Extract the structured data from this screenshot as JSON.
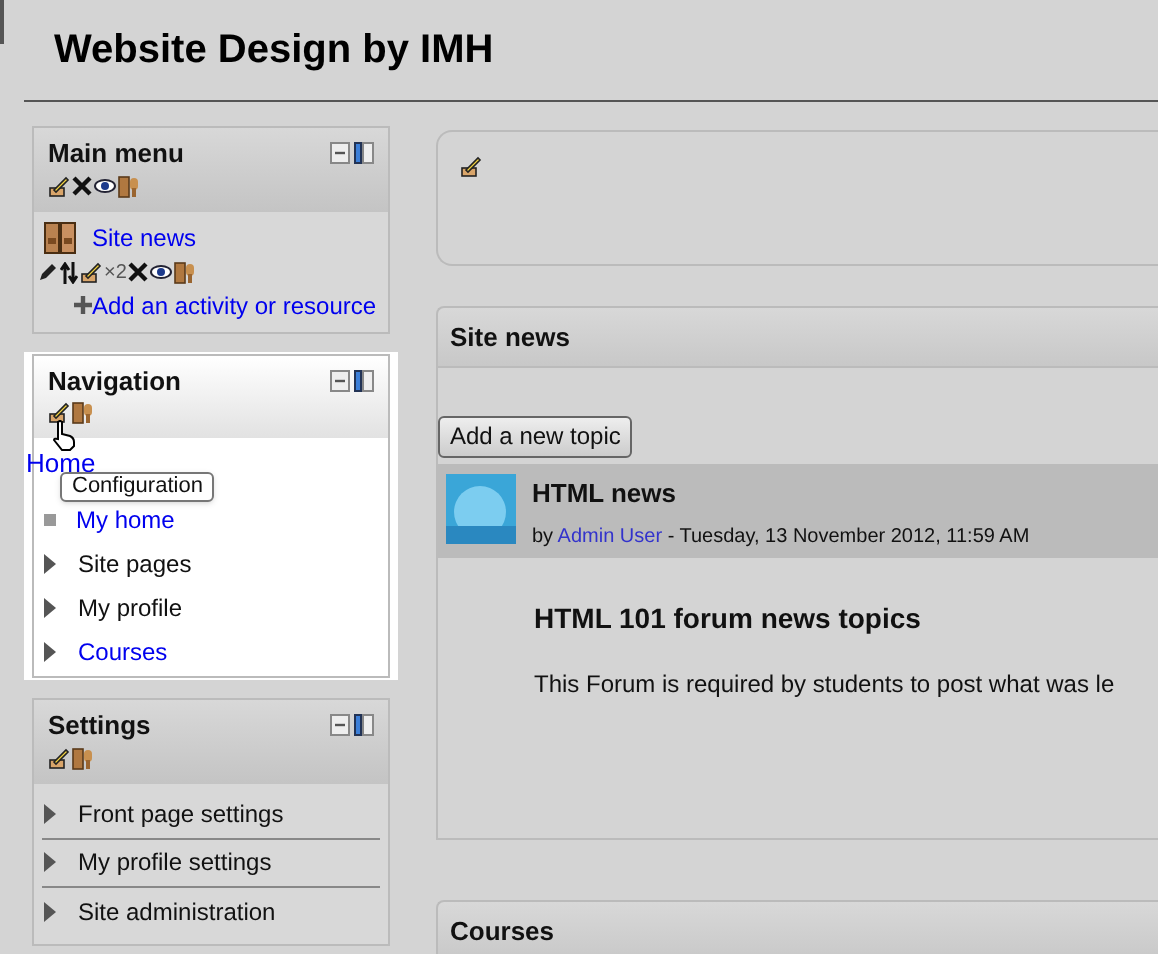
{
  "header": {
    "title": "Website Design by IMH"
  },
  "blocks": [
    {
      "title": "Main menu",
      "highlighted": false,
      "items": [
        {
          "kind": "activity",
          "label": "Site news",
          "count": "×2"
        },
        {
          "kind": "add",
          "label": "Add an activity or resource"
        }
      ]
    },
    {
      "title": "Navigation",
      "highlighted": true,
      "tooltip": "Configuration",
      "items": [
        {
          "kind": "root",
          "label": "Home",
          "link": true
        },
        {
          "kind": "leaf",
          "label": "My home",
          "link": true
        },
        {
          "kind": "branch",
          "label": "Site pages",
          "link": false
        },
        {
          "kind": "branch",
          "label": "My profile",
          "link": false
        },
        {
          "kind": "branch",
          "label": "Courses",
          "link": true
        }
      ]
    },
    {
      "title": "Settings",
      "highlighted": false,
      "items": [
        {
          "kind": "branch",
          "label": "Front page settings",
          "link": false
        },
        {
          "kind": "branch",
          "label": "My profile settings",
          "link": false
        },
        {
          "kind": "branch",
          "label": "Site administration",
          "link": false
        }
      ]
    }
  ],
  "main": {
    "site_news": {
      "title": "Site news"
    },
    "button": "Add a new topic",
    "post": {
      "subject": "HTML news",
      "byline_before": "by",
      "author": "Admin User",
      "byline_after": "- Tuesday, 13 November 2012, 11:59 AM",
      "title": "HTML 101 forum news topics",
      "body": "This Forum is required by students to post what was le"
    },
    "courses": {
      "title": "Courses"
    }
  }
}
